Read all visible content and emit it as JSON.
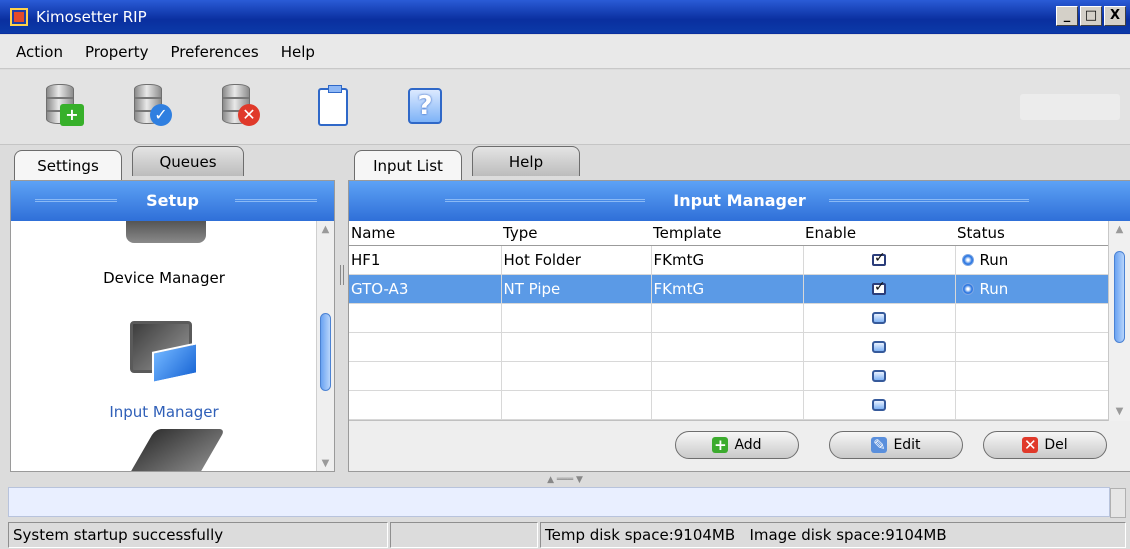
{
  "window": {
    "title": "Kimosetter RIP",
    "buttons": [
      "_",
      "□",
      "X"
    ]
  },
  "menu": [
    "Action",
    "Property",
    "Preferences",
    "Help"
  ],
  "toolbar": {
    "icons": [
      "database-add-icon",
      "database-check-icon",
      "database-delete-icon",
      "clipboard-icon",
      "help-icon"
    ],
    "help_glyph": "?",
    "add_glyph": "+",
    "check_glyph": "✓",
    "delete_glyph": "✕"
  },
  "left_tabs": {
    "settings": "Settings",
    "queues": "Queues"
  },
  "right_tabs": {
    "input_list": "Input List",
    "help": "Help"
  },
  "setup": {
    "title": "Setup",
    "items": [
      {
        "label": "Device Manager",
        "selected": false
      },
      {
        "label": "Input Manager",
        "selected": true
      }
    ]
  },
  "input_manager": {
    "title": "Input Manager",
    "columns": [
      "Name",
      "Type",
      "Template",
      "Enable",
      "Status"
    ],
    "rows": [
      {
        "name": "HF1",
        "type": "Hot Folder",
        "template": "FKmtG",
        "enable": true,
        "status": "Run",
        "selected": false
      },
      {
        "name": "GTO-A3",
        "type": "NT Pipe",
        "template": "FKmtG",
        "enable": true,
        "status": "Run",
        "selected": true
      },
      {
        "name": "",
        "type": "",
        "template": "",
        "enable": false,
        "status": "",
        "selected": false
      },
      {
        "name": "",
        "type": "",
        "template": "",
        "enable": false,
        "status": "",
        "selected": false
      },
      {
        "name": "",
        "type": "",
        "template": "",
        "enable": false,
        "status": "",
        "selected": false
      },
      {
        "name": "",
        "type": "",
        "template": "",
        "enable": false,
        "status": "",
        "selected": false
      }
    ],
    "buttons": {
      "add": "Add",
      "edit": "Edit",
      "del": "Del"
    }
  },
  "status": {
    "message": "System startup successfully",
    "empty": "",
    "temp_disk": "Temp disk space:9104MB",
    "image_disk": "Image disk space:9104MB"
  },
  "colors": {
    "accent": "#3d84ea",
    "selection": "#5b9ae6",
    "title_bar": "#0a2f9f"
  }
}
